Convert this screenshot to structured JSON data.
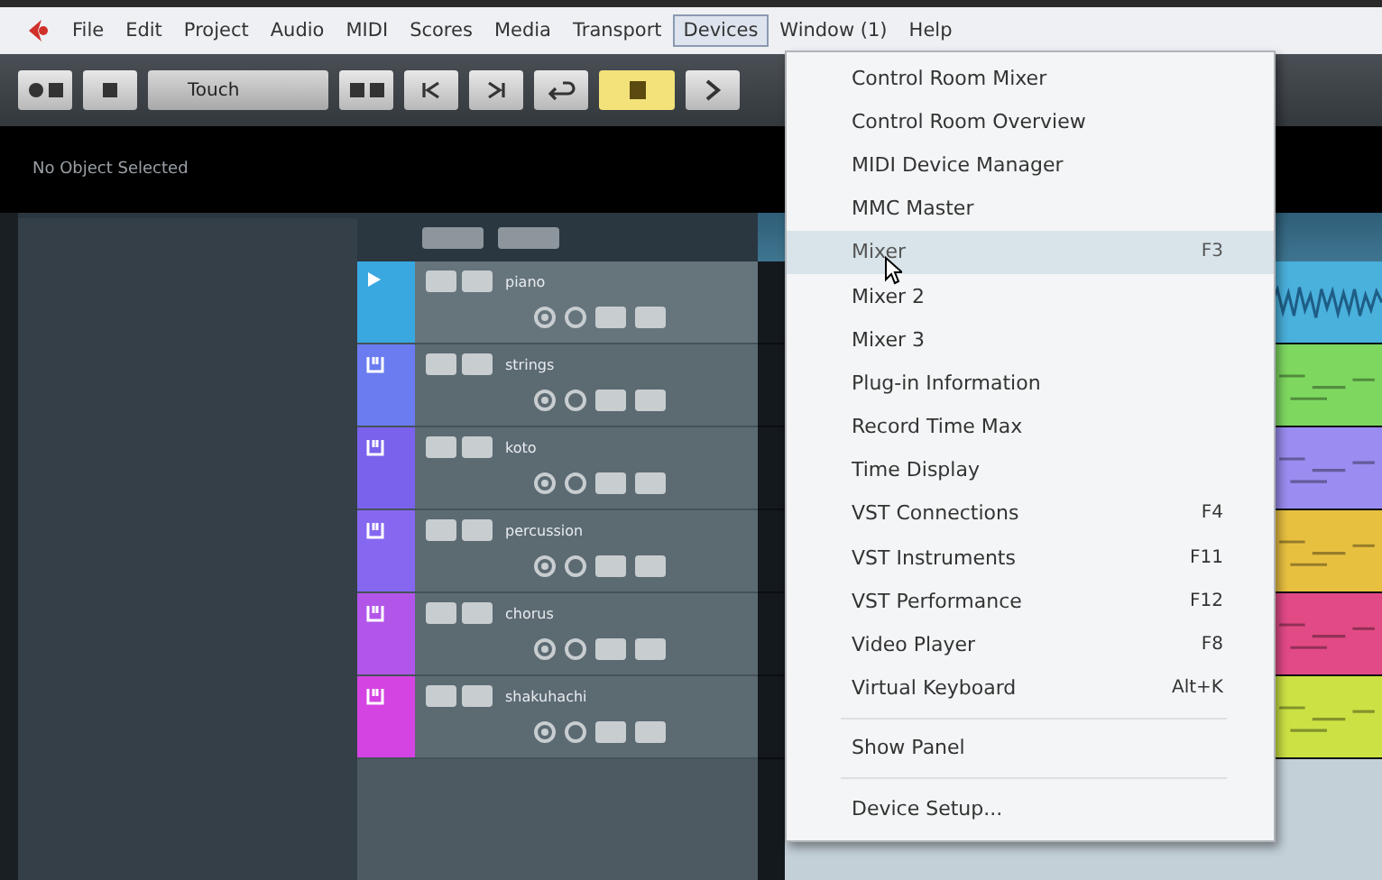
{
  "menu_bar": [
    {
      "label": "File",
      "selected": false
    },
    {
      "label": "Edit",
      "selected": false
    },
    {
      "label": "Project",
      "selected": false
    },
    {
      "label": "Audio",
      "selected": false
    },
    {
      "label": "MIDI",
      "selected": false
    },
    {
      "label": "Scores",
      "selected": false
    },
    {
      "label": "Media",
      "selected": false
    },
    {
      "label": "Transport",
      "selected": false
    },
    {
      "label": "Devices",
      "selected": true
    },
    {
      "label": "Window (1)",
      "selected": false
    },
    {
      "label": "Help",
      "selected": false
    }
  ],
  "toolbar": {
    "automation_mode": "Touch"
  },
  "info_line": "No Object Selected",
  "tracks": [
    {
      "name": "piano",
      "color": "#3aa8e0",
      "selected": true
    },
    {
      "name": "strings",
      "color": "#6a7cf0",
      "selected": false
    },
    {
      "name": "koto",
      "color": "#7a62ec",
      "selected": false
    },
    {
      "name": "percussion",
      "color": "#8668f0",
      "selected": false
    },
    {
      "name": "chorus",
      "color": "#b256ea",
      "selected": false
    },
    {
      "name": "shakuhachi",
      "color": "#d444e2",
      "selected": false
    }
  ],
  "lanes": [
    {
      "kind": "audio",
      "color": "#4ab0dc"
    },
    {
      "kind": "midi",
      "color": "#7ed860"
    },
    {
      "kind": "midi",
      "color": "#9a8cf0"
    },
    {
      "kind": "midi",
      "color": "#e8c040"
    },
    {
      "kind": "midi",
      "color": "#e24a86"
    },
    {
      "kind": "midi",
      "color": "#cce244"
    }
  ],
  "devices_menu": [
    {
      "kind": "item",
      "label": "Control Room Mixer",
      "selected": false
    },
    {
      "kind": "item",
      "label": "Control Room Overview",
      "selected": false
    },
    {
      "kind": "item",
      "label": "MIDI Device Manager",
      "selected": false
    },
    {
      "kind": "item",
      "label": "MMC Master",
      "selected": false
    },
    {
      "kind": "item",
      "label": "Mixer",
      "shortcut": "F3",
      "selected": true
    },
    {
      "kind": "item",
      "label": "Mixer 2",
      "selected": false
    },
    {
      "kind": "item",
      "label": "Mixer 3",
      "selected": false
    },
    {
      "kind": "item",
      "label": "Plug-in Information",
      "selected": false
    },
    {
      "kind": "item",
      "label": "Record Time Max",
      "selected": false
    },
    {
      "kind": "item",
      "label": "Time Display",
      "selected": false
    },
    {
      "kind": "item",
      "label": "VST Connections",
      "shortcut": "F4",
      "selected": false
    },
    {
      "kind": "item",
      "label": "VST Instruments",
      "shortcut": "F11",
      "selected": false
    },
    {
      "kind": "item",
      "label": "VST Performance",
      "shortcut": "F12",
      "selected": false
    },
    {
      "kind": "item",
      "label": "Video Player",
      "shortcut": "F8",
      "selected": false
    },
    {
      "kind": "item",
      "label": "Virtual Keyboard",
      "shortcut": "Alt+K",
      "selected": false
    },
    {
      "kind": "separator"
    },
    {
      "kind": "item",
      "label": "Show Panel",
      "selected": false
    },
    {
      "kind": "separator"
    },
    {
      "kind": "item",
      "label": "Device Setup...",
      "selected": false
    }
  ]
}
